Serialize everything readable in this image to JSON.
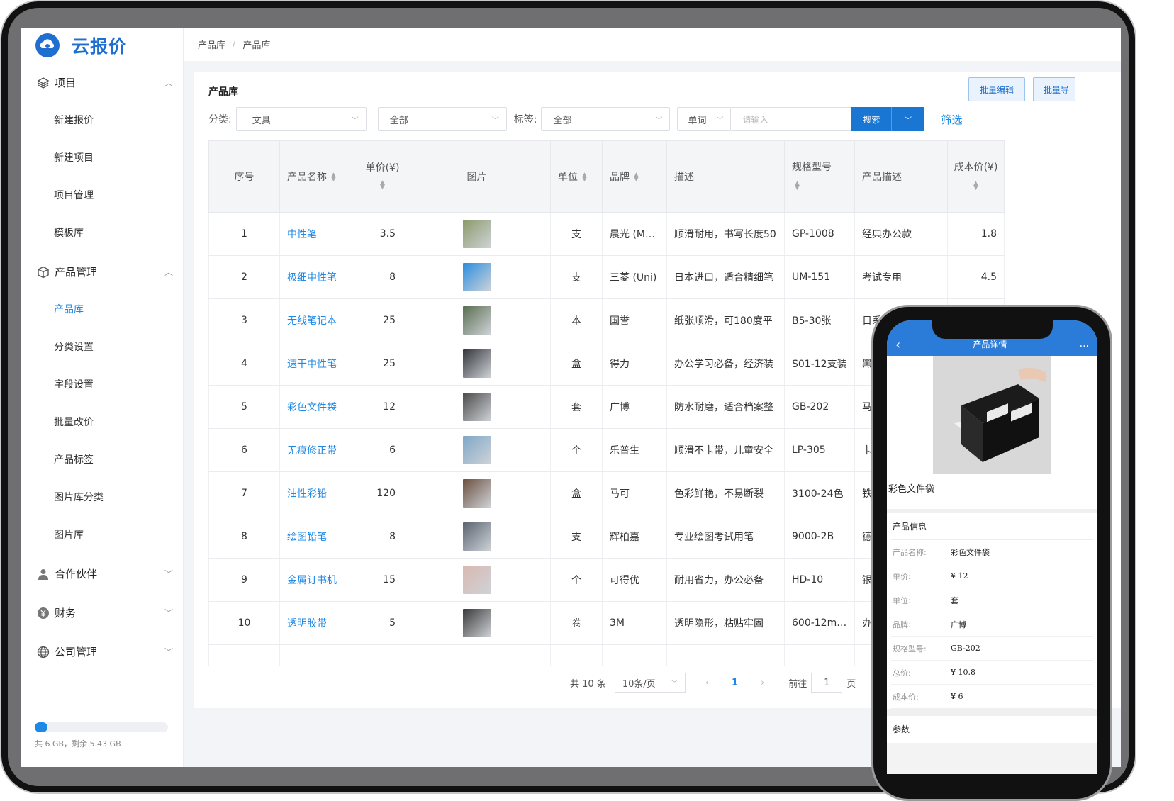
{
  "app": {
    "name": "云报价"
  },
  "breadcrumb": [
    "产品库",
    "产品库"
  ],
  "sidebar": {
    "groups": [
      {
        "label": "项目",
        "icon": "layers-icon",
        "expanded": true,
        "items": [
          "新建报价",
          "新建项目",
          "项目管理",
          "模板库"
        ]
      },
      {
        "label": "产品管理",
        "icon": "cube-icon",
        "expanded": true,
        "items": [
          "产品库",
          "分类设置",
          "字段设置",
          "批量改价",
          "产品标签",
          "图片库分类",
          "图片库"
        ]
      },
      {
        "label": "合作伙伴",
        "icon": "user-icon",
        "expanded": false,
        "items": []
      },
      {
        "label": "财务",
        "icon": "yen-icon",
        "expanded": false,
        "items": []
      },
      {
        "label": "公司管理",
        "icon": "globe-icon",
        "expanded": false,
        "items": []
      }
    ],
    "active_item": "产品库",
    "storage": {
      "text": "共 6 GB，剩余 5.43 GB",
      "used_fraction": 0.095
    }
  },
  "main": {
    "title": "产品库",
    "buttons": {
      "batch_edit": "批量编辑",
      "batch_export": "批量导"
    },
    "filters": {
      "category_label": "分类:",
      "category_value": "文具",
      "category2_value": "全部",
      "tag_label": "标签:",
      "tag_value": "全部",
      "search_field": "单词",
      "search_placeholder": "请输入",
      "search_button": "搜索",
      "filter_link": "筛选"
    },
    "table": {
      "headers": [
        "序号",
        "产品名称",
        "单价(¥)",
        "图片",
        "单位",
        "品牌",
        "描述",
        "规格型号",
        "产品描述",
        "成本价(¥)"
      ],
      "rows": [
        {
          "no": "1",
          "name": "中性笔",
          "price": "3.5",
          "unit": "支",
          "brand": "晨光 (M…",
          "desc": "顺滑耐用，书写长度50",
          "model": "GP-1008",
          "pdesc": "经典办公款",
          "cost": "1.8",
          "img": "#8a9a6a"
        },
        {
          "no": "2",
          "name": "极细中性笔",
          "price": "8",
          "unit": "支",
          "brand": "三菱 (Uni)",
          "desc": "日本进口，适合精细笔",
          "model": "UM-151",
          "pdesc": "考试专用",
          "cost": "4.5",
          "img": "#2a8de0"
        },
        {
          "no": "3",
          "name": "无线笔记本",
          "price": "25",
          "unit": "本",
          "brand": "国誉",
          "desc": "纸张顺滑，可180度平",
          "model": "B5-30张",
          "pdesc": "日系简",
          "cost": "",
          "img": "#5a6e52"
        },
        {
          "no": "4",
          "name": "速干中性笔",
          "price": "25",
          "unit": "盒",
          "brand": "得力",
          "desc": "办公学习必备，经济装",
          "model": "S01-12支装",
          "pdesc": "黑色",
          "cost": "",
          "img": "#33363b"
        },
        {
          "no": "5",
          "name": "彩色文件袋",
          "price": "12",
          "unit": "套",
          "brand": "广博",
          "desc": "防水耐磨，适合档案整",
          "model": "GB-202",
          "pdesc": "马卡",
          "cost": "",
          "img": "#4a4a4a"
        },
        {
          "no": "6",
          "name": "无痕修正带",
          "price": "6",
          "unit": "个",
          "brand": "乐普生",
          "desc": "顺滑不卡带，儿童安全",
          "model": "LP-305",
          "pdesc": "卡通",
          "cost": "",
          "img": "#7fa7c7"
        },
        {
          "no": "7",
          "name": "油性彩铅",
          "price": "120",
          "unit": "盒",
          "brand": "马可",
          "desc": "色彩鲜艳，不易断裂",
          "model": "3100-24色",
          "pdesc": "铁盒",
          "cost": "",
          "img": "#6b5040"
        },
        {
          "no": "8",
          "name": "绘图铅笔",
          "price": "8",
          "unit": "支",
          "brand": "辉柏嘉",
          "desc": "专业绘图考试用笔",
          "model": "9000-2B",
          "pdesc": "德国",
          "cost": "",
          "img": "#5a6470"
        },
        {
          "no": "9",
          "name": "金属订书机",
          "price": "15",
          "unit": "个",
          "brand": "可得优",
          "desc": "耐用省力，办公必备",
          "model": "HD-10",
          "pdesc": "银色",
          "cost": "",
          "img": "#d9b8b0"
        },
        {
          "no": "10",
          "name": "透明胶带",
          "price": "5",
          "unit": "卷",
          "brand": "3M",
          "desc": "透明隐形，粘贴牢固",
          "model": "600-12m…",
          "pdesc": "办公",
          "cost": "",
          "img": "#3a3a3a"
        }
      ]
    },
    "pagination": {
      "total": "共 10 条",
      "page_size": "10条/页",
      "current": "1",
      "goto_label": "前往",
      "goto_value": "1",
      "page_suffix": "页"
    }
  },
  "phone": {
    "header_title": "产品详情",
    "product_name": "彩色文件袋",
    "section_title": "产品信息",
    "fields": [
      {
        "k": "产品名称:",
        "v": "彩色文件袋"
      },
      {
        "k": "单价:",
        "v": "¥ 12"
      },
      {
        "k": "单位:",
        "v": "套"
      },
      {
        "k": "品牌:",
        "v": "广博"
      },
      {
        "k": "规格型号:",
        "v": "GB-202"
      },
      {
        "k": "总价:",
        "v": "¥ 10.8"
      },
      {
        "k": "成本价:",
        "v": "¥ 6"
      }
    ],
    "params_title": "参数"
  },
  "colors": {
    "accent": "#1e88e5",
    "primary_button": "#1976d2",
    "phone_header": "#2b7bd8"
  }
}
